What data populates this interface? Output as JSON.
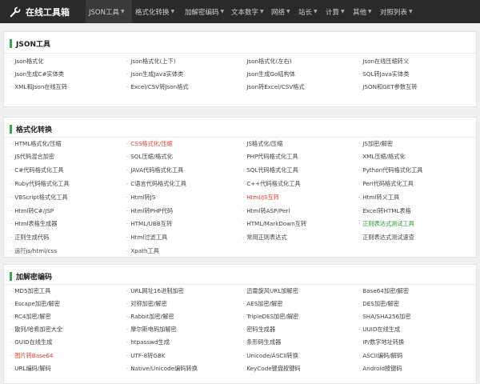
{
  "brand": {
    "name": "在线工具箱",
    "icon": "wrench-icon"
  },
  "nav": [
    {
      "label": "JSON工具",
      "id": "json",
      "caret": true,
      "active": true
    },
    {
      "label": "格式化转换",
      "id": "format",
      "caret": true
    },
    {
      "label": "加解密编码",
      "id": "crypto",
      "caret": true
    },
    {
      "label": "文本数字",
      "id": "text",
      "caret": true
    },
    {
      "label": "网络",
      "id": "network",
      "caret": true
    },
    {
      "label": "站长",
      "id": "webmaster",
      "caret": true
    },
    {
      "label": "计算",
      "id": "calc",
      "caret": true
    },
    {
      "label": "其他",
      "id": "other",
      "caret": true
    },
    {
      "label": "对照列表",
      "id": "reference",
      "caret": true
    }
  ],
  "sections": [
    {
      "title": "JSON工具",
      "items": [
        {
          "label": "Json格式化"
        },
        {
          "label": "Json格式化(上下)"
        },
        {
          "label": "Json格式化(左右)"
        },
        {
          "label": "Json在线压缩转义"
        },
        {
          "label": "Json生成C#实体类"
        },
        {
          "label": "Json生成Java实体类"
        },
        {
          "label": "Json生成Go结构体"
        },
        {
          "label": "SQL转Java实体类"
        },
        {
          "label": "XML和Json在线互转"
        },
        {
          "label": "Excel/CSV转Json格式"
        },
        {
          "label": "Json转Excel/CSV格式"
        },
        {
          "label": "JSON和GET参数互转"
        }
      ]
    },
    {
      "title": "格式化转换",
      "items": [
        {
          "label": "HTML格式化/压缩"
        },
        {
          "label": "CSS格式化/压缩",
          "color": "red"
        },
        {
          "label": "JS格式化/压缩"
        },
        {
          "label": "JS加密/解密"
        },
        {
          "label": "JS代码混合加密"
        },
        {
          "label": "SQL压缩/格式化"
        },
        {
          "label": "PHP代码格式化工具"
        },
        {
          "label": "XML压缩/格式化"
        },
        {
          "label": "C#代码格式化工具"
        },
        {
          "label": "JAVA代码格式化工具"
        },
        {
          "label": "SQL代码格式化工具"
        },
        {
          "label": "Python代码格式化工具"
        },
        {
          "label": "Ruby代码格式化工具"
        },
        {
          "label": "C语言代码格式化工具"
        },
        {
          "label": "C++代码格式化工具"
        },
        {
          "label": "Perl代码格式化工具"
        },
        {
          "label": "VBScript格式化工具"
        },
        {
          "label": "Html转JS"
        },
        {
          "label": "Html/JS互转",
          "color": "red"
        },
        {
          "label": "Html转义工具"
        },
        {
          "label": "Html转C#/JSP"
        },
        {
          "label": "Html转PHP代码"
        },
        {
          "label": "Html转ASP/Perl"
        },
        {
          "label": "Excel转HTML表格"
        },
        {
          "label": "Html表格生成器"
        },
        {
          "label": "HTML/UBB互转"
        },
        {
          "label": "HTML/MarkDown互转"
        },
        {
          "label": "正则表达式测试工具",
          "color": "green"
        },
        {
          "label": "正则生成代码"
        },
        {
          "label": "Html过滤工具"
        },
        {
          "label": "常用正则表达式"
        },
        {
          "label": "正则表达式测试速查"
        },
        {
          "label": "运行js/html/css"
        },
        {
          "label": "Xpath工具"
        }
      ]
    },
    {
      "title": "加解密编码",
      "items": [
        {
          "label": "MD5加密工具"
        },
        {
          "label": "URL网址16进制加密"
        },
        {
          "label": "迅雷旋风URL加解密"
        },
        {
          "label": "Base64加密/解密"
        },
        {
          "label": "Escape加密/解密"
        },
        {
          "label": "对称加密/解密"
        },
        {
          "label": "AES加密/解密"
        },
        {
          "label": "DES加密/解密"
        },
        {
          "label": "RC4加密/解密"
        },
        {
          "label": "Rabbit加密/解密"
        },
        {
          "label": "TripleDES加密/解密"
        },
        {
          "label": "SHA/SHA256加密"
        },
        {
          "label": "散列/哈希加密大全"
        },
        {
          "label": "摩尔斯电码加解密"
        },
        {
          "label": "密码生成器"
        },
        {
          "label": "UUID在线生成"
        },
        {
          "label": "GUID在线生成"
        },
        {
          "label": "htpasswd生成"
        },
        {
          "label": "条形码生成器"
        },
        {
          "label": "IP/数字地址转换"
        },
        {
          "label": "图片转Base64",
          "color": "red"
        },
        {
          "label": "UTF-8转GBK"
        },
        {
          "label": "Unicode/ASCII转换"
        },
        {
          "label": "ASCII编码/解码"
        },
        {
          "label": "URL编码/解码"
        },
        {
          "label": "Native/Unicode编码转换"
        },
        {
          "label": "KeyCode键盘按键码"
        },
        {
          "label": "Android按键码"
        }
      ]
    }
  ]
}
